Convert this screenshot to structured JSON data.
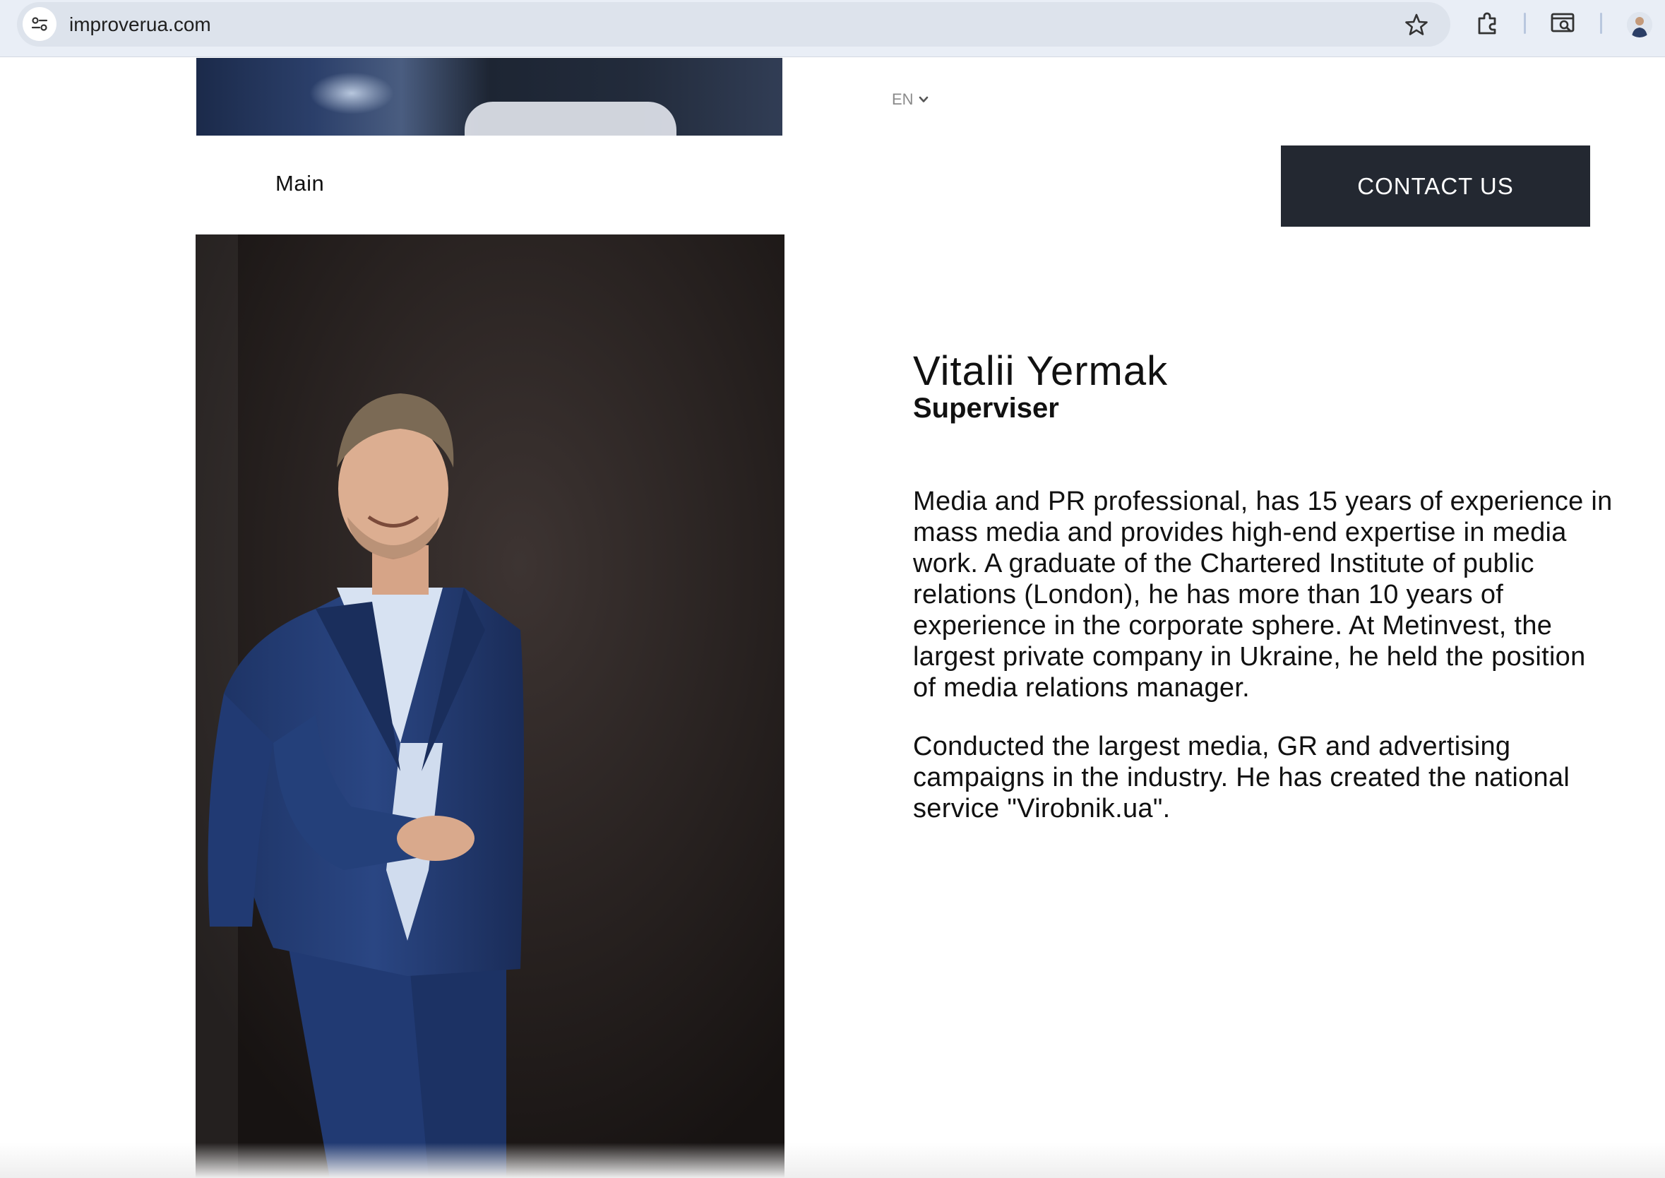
{
  "browser": {
    "url": "improverua.com",
    "icons": {
      "site_info": "tune-icon",
      "bookmark": "star-icon",
      "extensions": "puzzle-icon",
      "search_tab": "tab-search-icon",
      "profile": "profile-avatar"
    }
  },
  "header": {
    "language": "EN",
    "nav": {
      "main_label": "Main"
    },
    "contact_label": "CONTACT US"
  },
  "profile": {
    "name": "Vitalii Yermak",
    "role": "Superviser",
    "bio": [
      {
        "lines": [
          "Media and PR professional, has 15 years of experience in",
          "mass media and provides high-end expertise in media",
          "work. A graduate of the Chartered Institute of public",
          "relations (London), he has more than 10 years of",
          "experience in the corporate sphere. At Metinvest, the",
          "largest private company in Ukraine, he held the position",
          "of media relations manager."
        ]
      },
      {
        "lines": [
          "Conducted the largest media, GR and advertising",
          "campaigns in the industry. He has created the national",
          "service \"Virobnik.ua\"."
        ]
      }
    ]
  },
  "colors": {
    "button_bg": "#232831",
    "text": "#111111",
    "browser_bar": "#e9eef6"
  }
}
